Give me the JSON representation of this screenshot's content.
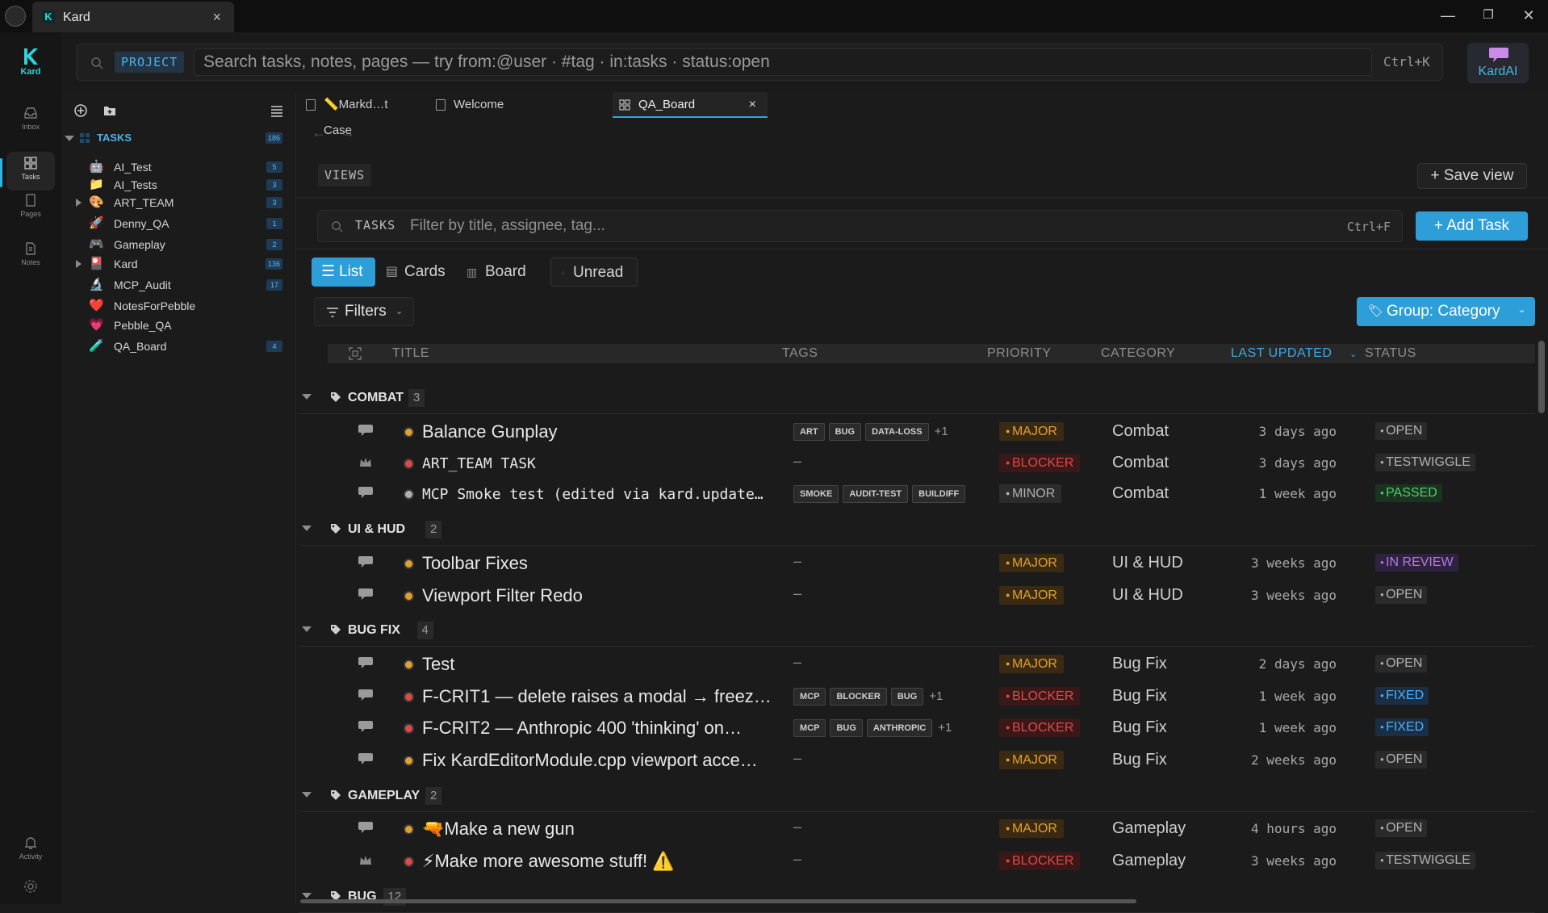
{
  "window": {
    "tab_title": "Kard",
    "close_glyph": "×",
    "minimize_glyph": "—",
    "maximize_glyph": "❐",
    "close_window_glyph": "✕"
  },
  "rail": {
    "logo_text": "Kard",
    "items": [
      {
        "label": "Inbox",
        "icon": "inbox-icon"
      },
      {
        "label": "Tasks",
        "icon": "grid-icon",
        "active": true
      },
      {
        "label": "Pages",
        "icon": "page-icon"
      },
      {
        "label": "Notes",
        "icon": "note-icon"
      },
      {
        "label": "Activity",
        "icon": "bell-icon"
      }
    ]
  },
  "search": {
    "scope_chip": "PROJECT",
    "placeholder": "Search tasks, notes, pages — try from:@user · #tag · in:tasks · status:open",
    "shortcut": "Ctrl+K"
  },
  "assistant": {
    "label": "KardAI"
  },
  "tree": {
    "root": {
      "label": "TASKS",
      "count": "186"
    },
    "items": [
      {
        "label": "AI_Test",
        "emoji": "🤖",
        "count": "5",
        "expandable": false
      },
      {
        "label": "AI_Tests",
        "emoji": "📁",
        "count": "3",
        "expandable": false
      },
      {
        "label": "ART_TEAM",
        "emoji": "🎨",
        "count": "3",
        "expandable": true
      },
      {
        "label": "Denny_QA",
        "emoji": "🚀",
        "count": "1",
        "expandable": false
      },
      {
        "label": "Gameplay",
        "emoji": "🎮",
        "count": "2",
        "expandable": false
      },
      {
        "label": "Kard",
        "emoji": "🎴",
        "count": "136",
        "expandable": true
      },
      {
        "label": "MCP_Audit",
        "emoji": "🔬",
        "count": "17",
        "expandable": false
      },
      {
        "label": "NotesForPebble",
        "emoji": "❤️",
        "count": "",
        "expandable": false
      },
      {
        "label": "Pebble_QA",
        "emoji": "💗",
        "count": "",
        "expandable": false
      },
      {
        "label": "QA_Board",
        "emoji": "🧪",
        "count": "4",
        "expandable": false
      }
    ]
  },
  "doc_tabs": [
    {
      "label": "📏Markd…t Case",
      "active": false
    },
    {
      "label": "Welcome",
      "active": false
    },
    {
      "label": "QA_Board",
      "active": true,
      "close": "×"
    }
  ],
  "nav": {
    "back": "←",
    "forward": "→"
  },
  "views": {
    "chip": "VIEWS",
    "save_label": "+ Save view"
  },
  "task_filter": {
    "chip": "TASKS",
    "placeholder": "Filter by title, assignee, tag...",
    "shortcut": "Ctrl+F"
  },
  "add_task_label": "+ Add Task",
  "view_tabs": [
    {
      "label": "List",
      "active": true
    },
    {
      "label": "Cards",
      "active": false
    },
    {
      "label": "Board",
      "active": false
    },
    {
      "label": "Unread",
      "active": false
    }
  ],
  "filters_label": "Filters",
  "group_label": "Group: Category",
  "columns": {
    "title": "TITLE",
    "tags": "TAGS",
    "priority": "PRIORITY",
    "category": "CATEGORY",
    "last_updated": "LAST UPDATED",
    "status": "STATUS"
  },
  "colors": {
    "accent": "#2e9ed8",
    "major": "#e0a030",
    "blocker": "#e04848",
    "minor": "#b0b0b0",
    "passed": "#4ccf6a",
    "in_review": "#b07ae0",
    "fixed": "#4fb0ff"
  },
  "groups": [
    {
      "label": "COMBAT",
      "count": "3",
      "tasks": [
        {
          "icon": "comment-icon",
          "title": "Balance Gunplay",
          "mono": false,
          "tags": [
            "ART",
            "BUG",
            "DATA-LOSS"
          ],
          "more": "+1",
          "priority": "MAJOR",
          "category": "Combat",
          "updated": "3 days ago",
          "status": "OPEN"
        },
        {
          "icon": "crown-icon",
          "title": "ART_TEAM TASK",
          "mono": true,
          "tags": [],
          "more": "",
          "priority": "BLOCKER",
          "category": "Combat",
          "updated": "3 days ago",
          "status": "TESTWIGGLE"
        },
        {
          "icon": "comment-icon",
          "title": "MCP Smoke test (edited via kard.update…",
          "mono": true,
          "tags": [
            "SMOKE",
            "AUDIT-TEST",
            "BUILDIFF"
          ],
          "more": "",
          "priority": "MINOR",
          "category": "Combat",
          "updated": "1 week ago",
          "status": "PASSED"
        }
      ]
    },
    {
      "label": "UI & HUD",
      "count": "2",
      "tasks": [
        {
          "icon": "comment-icon",
          "title": "Toolbar Fixes",
          "mono": false,
          "tags": [],
          "more": "",
          "priority": "MAJOR",
          "category": "UI & HUD",
          "updated": "3 weeks ago",
          "status": "IN REVIEW"
        },
        {
          "icon": "comment-icon",
          "title": "Viewport Filter Redo",
          "mono": false,
          "tags": [],
          "more": "",
          "priority": "MAJOR",
          "category": "UI & HUD",
          "updated": "3 weeks ago",
          "status": "OPEN"
        }
      ]
    },
    {
      "label": "BUG FIX",
      "count": "4",
      "tasks": [
        {
          "icon": "comment-icon",
          "title": "Test",
          "mono": false,
          "tags": [],
          "more": "",
          "priority": "MAJOR",
          "category": "Bug Fix",
          "updated": "2 days ago",
          "status": "OPEN"
        },
        {
          "icon": "comment-icon",
          "title": "F-CRIT1 — delete raises a modal → freez…",
          "mono": false,
          "tags": [
            "MCP",
            "BLOCKER",
            "BUG"
          ],
          "more": "+1",
          "priority": "BLOCKER",
          "category": "Bug Fix",
          "updated": "1 week ago",
          "status": "FIXED"
        },
        {
          "icon": "comment-icon",
          "title": "F-CRIT2 — Anthropic 400 'thinking' on…",
          "mono": false,
          "tags": [
            "MCP",
            "BUG",
            "ANTHROPIC"
          ],
          "more": "+1",
          "priority": "BLOCKER",
          "category": "Bug Fix",
          "updated": "1 week ago",
          "status": "FIXED"
        },
        {
          "icon": "comment-icon",
          "title": "Fix KardEditorModule.cpp viewport acce…",
          "mono": false,
          "tags": [],
          "more": "",
          "priority": "MAJOR",
          "category": "Bug Fix",
          "updated": "2 weeks ago",
          "status": "OPEN"
        }
      ]
    },
    {
      "label": "GAMEPLAY",
      "count": "2",
      "tasks": [
        {
          "icon": "comment-icon",
          "title": "🔫Make a new gun",
          "mono": false,
          "tags": [],
          "more": "",
          "priority": "MAJOR",
          "category": "Gameplay",
          "updated": "4 hours ago",
          "status": "OPEN"
        },
        {
          "icon": "crown-icon",
          "title": "⚡Make more awesome stuff! ⚠️",
          "mono": false,
          "tags": [],
          "more": "",
          "priority": "BLOCKER",
          "category": "Gameplay",
          "updated": "3 weeks ago",
          "status": "TESTWIGGLE"
        }
      ]
    },
    {
      "label": "BUG",
      "count": "12",
      "tasks": []
    }
  ],
  "empty_value": "–"
}
